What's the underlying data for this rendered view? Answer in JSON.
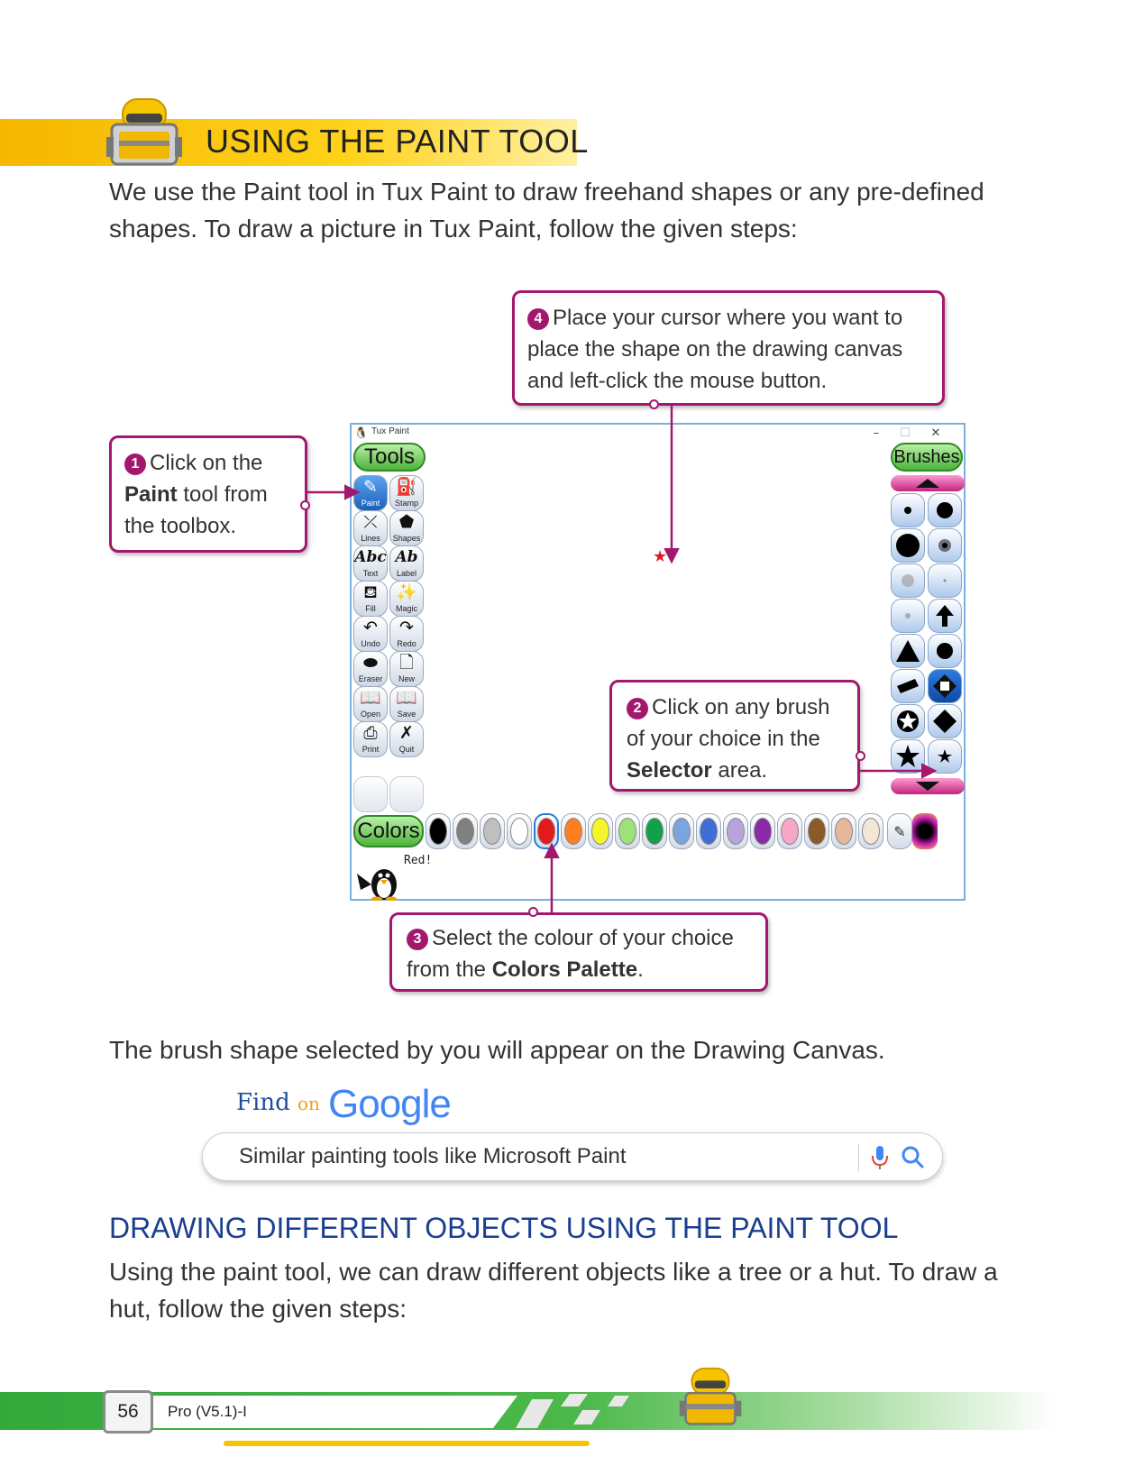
{
  "section": {
    "title": "USING THE PAINT TOOL",
    "intro": "We use the Paint tool in Tux Paint to draw freehand shapes or any pre-defined shapes. To draw a picture in Tux Paint, follow the given steps:"
  },
  "callouts": {
    "step1": {
      "num": "1",
      "pre": "Click on the",
      "bold": "Paint",
      "post": "tool from the toolbox."
    },
    "step2": {
      "num": "2",
      "pre": "Click on any brush of your choice in the",
      "bold": "Selector",
      "post": "area."
    },
    "step3": {
      "num": "3",
      "pre": "Select the colour of your choice from the",
      "bold": "Colors Palette",
      "post": "."
    },
    "step4": {
      "num": "4",
      "text": "Place your cursor where you want to place the shape on the drawing canvas and left-click the mouse button."
    }
  },
  "tuxpaint": {
    "window_title": "Tux Paint",
    "tools_label": "Tools",
    "brushes_label": "Brushes",
    "colors_label": "Colors",
    "status_text": "Red!",
    "tools": [
      {
        "label": "Paint",
        "icon": "paintbrush-icon",
        "glyph": "✎"
      },
      {
        "label": "Stamp",
        "icon": "stamp-icon",
        "glyph": "⛽"
      },
      {
        "label": "Lines",
        "icon": "lines-icon",
        "glyph": "⤫"
      },
      {
        "label": "Shapes",
        "icon": "pentagon-icon",
        "glyph": "⬟"
      },
      {
        "label": "Text",
        "icon": "text-icon",
        "glyph": "Abc"
      },
      {
        "label": "Label",
        "icon": "label-icon",
        "glyph": "Ab"
      },
      {
        "label": "Fill",
        "icon": "bucket-icon",
        "glyph": "⛾"
      },
      {
        "label": "Magic",
        "icon": "magic-wand-icon",
        "glyph": "✨"
      },
      {
        "label": "Undo",
        "icon": "undo-icon",
        "glyph": "↶"
      },
      {
        "label": "Redo",
        "icon": "redo-icon",
        "glyph": "↷"
      },
      {
        "label": "Eraser",
        "icon": "eraser-icon",
        "glyph": "⬬"
      },
      {
        "label": "New",
        "icon": "new-page-icon",
        "glyph": "🗋"
      },
      {
        "label": "Open",
        "icon": "open-book-icon",
        "glyph": "📖"
      },
      {
        "label": "Save",
        "icon": "save-book-icon",
        "glyph": "📖"
      },
      {
        "label": "Print",
        "icon": "printer-icon",
        "glyph": "⎙"
      },
      {
        "label": "Quit",
        "icon": "quit-icon",
        "glyph": "✗"
      }
    ],
    "brushes": [
      "small-dot-icon",
      "medium-dot-icon",
      "large-dot-icon",
      "fuzzy-dot-icon",
      "faint-dot-icon",
      "tiny-dot-icon",
      "faint-small-dot-icon",
      "arrow-up-icon",
      "triangle-icon",
      "dot-icon",
      "diamond-flat-icon",
      "square-outline-icon",
      "star-circle-icon",
      "diamond-icon",
      "star-icon",
      "small-star-icon"
    ],
    "colors": [
      {
        "name": "black",
        "hex": "#000000"
      },
      {
        "name": "dark-gray",
        "hex": "#808080"
      },
      {
        "name": "light-gray",
        "hex": "#bfbfbf"
      },
      {
        "name": "white",
        "hex": "#ffffff"
      },
      {
        "name": "red",
        "hex": "#e11b1b"
      },
      {
        "name": "orange",
        "hex": "#ff7f1e"
      },
      {
        "name": "yellow",
        "hex": "#f5f52a"
      },
      {
        "name": "light-green",
        "hex": "#9ee07a"
      },
      {
        "name": "green",
        "hex": "#11a14a"
      },
      {
        "name": "sky-blue",
        "hex": "#7aa6e0"
      },
      {
        "name": "blue",
        "hex": "#3f6fd6"
      },
      {
        "name": "lavender",
        "hex": "#b9a3de"
      },
      {
        "name": "purple",
        "hex": "#8a2aa8"
      },
      {
        "name": "pink",
        "hex": "#f7a6c8"
      },
      {
        "name": "brown",
        "hex": "#8a5a2a"
      },
      {
        "name": "tan",
        "hex": "#e6b79a"
      },
      {
        "name": "cream",
        "hex": "#f3e6d6"
      }
    ]
  },
  "brush_note": "The brush shape selected by you will appear on the Drawing Canvas.",
  "find_on": {
    "label_find": "Find",
    "label_on": "on",
    "brand": "Google",
    "query": "Similar painting tools like Microsoft Paint"
  },
  "subsection": {
    "title": "DRAWING DIFFERENT OBJECTS USING THE PAINT TOOL",
    "text": "Using the paint tool, we can draw different objects like a tree or a hut. To draw a hut, follow the given steps:"
  },
  "footer": {
    "page_number": "56",
    "book": "Pro (V5.1)-I"
  },
  "colors": {
    "accent_magenta": "#a3186d",
    "heading_band": "#ffd21a",
    "subheading_blue": "#1b3f8f",
    "footer_green": "#33a93c"
  }
}
